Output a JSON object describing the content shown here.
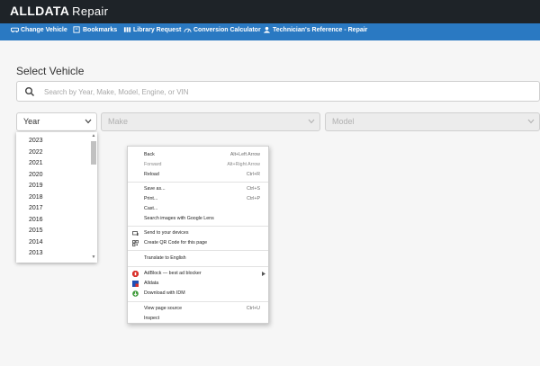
{
  "app": {
    "brand": "ALLDATA",
    "product": "Repair"
  },
  "nav": [
    {
      "label": "Change Vehicle",
      "icon": "car-icon"
    },
    {
      "label": "Bookmarks",
      "icon": "bookmark-icon"
    },
    {
      "label": "Library Request",
      "icon": "library-icon"
    },
    {
      "label": "Conversion Calculator",
      "icon": "gauge-icon"
    },
    {
      "label": "Technician's Reference - Repair",
      "icon": "reference-icon"
    }
  ],
  "page_title": "Select Vehicle",
  "search": {
    "placeholder": "Search by Year, Make, Model, Engine, or VIN"
  },
  "selects": {
    "year": "Year",
    "make": "Make",
    "model": "Model"
  },
  "years": [
    "2023",
    "2022",
    "2021",
    "2020",
    "2019",
    "2018",
    "2017",
    "2016",
    "2015",
    "2014",
    "2013"
  ],
  "context_menu": {
    "back": {
      "label": "Back",
      "shortcut": "Alt+Left Arrow"
    },
    "forward": {
      "label": "Forward",
      "shortcut": "Alt+Right Arrow"
    },
    "reload": {
      "label": "Reload",
      "shortcut": "Ctrl+R"
    },
    "save_as": {
      "label": "Save as...",
      "shortcut": "Ctrl+S"
    },
    "print": {
      "label": "Print...",
      "shortcut": "Ctrl+P"
    },
    "cast": {
      "label": "Cast..."
    },
    "lens": {
      "label": "Search images with Google Lens"
    },
    "send": {
      "label": "Send to your devices"
    },
    "qr": {
      "label": "Create QR Code for this page"
    },
    "translate": {
      "label": "Translate to English"
    },
    "adblock": {
      "label": "AdBlock — best ad blocker"
    },
    "alldata": {
      "label": "Alldata"
    },
    "idm": {
      "label": "Download with IDM"
    },
    "view_source": {
      "label": "View page source",
      "shortcut": "Ctrl+U"
    },
    "inspect": {
      "label": "Inspect"
    }
  },
  "colors": {
    "topbar": "#1e2328",
    "navbar": "#2a79c2",
    "adblock_red": "#d9302a",
    "alldata_blue": "#1f4fb5",
    "idm_green": "#3f9b3a"
  }
}
